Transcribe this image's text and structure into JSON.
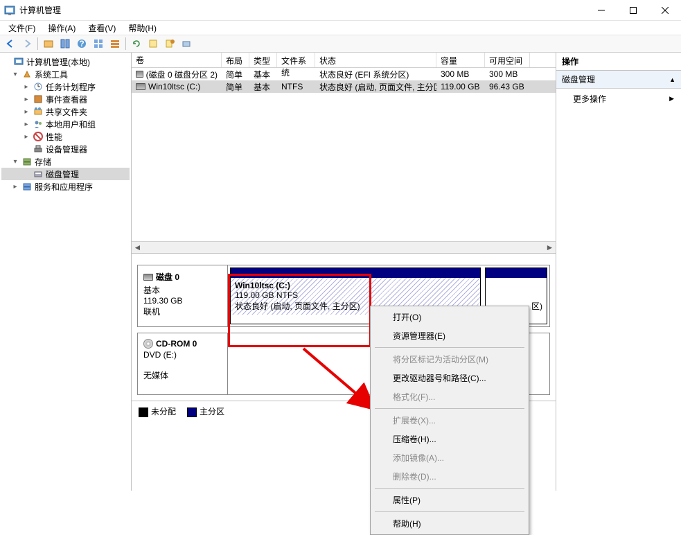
{
  "window": {
    "title": "计算机管理"
  },
  "menus": {
    "file": "文件(F)",
    "action": "操作(A)",
    "view": "查看(V)",
    "help": "帮助(H)"
  },
  "tree": {
    "root": "计算机管理(本地)",
    "system_tools": "系统工具",
    "task_scheduler": "任务计划程序",
    "event_viewer": "事件查看器",
    "shared_folders": "共享文件夹",
    "local_users": "本地用户和组",
    "performance": "性能",
    "device_manager": "设备管理器",
    "storage": "存储",
    "disk_management": "磁盘管理",
    "services_apps": "服务和应用程序"
  },
  "volcols": {
    "volume": "卷",
    "layout": "布局",
    "type": "类型",
    "fs": "文件系统",
    "status": "状态",
    "capacity": "容量",
    "free": "可用空间"
  },
  "volumes": [
    {
      "name": "(磁盘 0 磁盘分区 2)",
      "layout": "简单",
      "type": "基本",
      "fs": "",
      "status": "状态良好 (EFI 系统分区)",
      "capacity": "300 MB",
      "free": "300 MB"
    },
    {
      "name": "Win10ltsc (C:)",
      "layout": "简单",
      "type": "基本",
      "fs": "NTFS",
      "status": "状态良好 (启动, 页面文件, 主分区)",
      "capacity": "119.00 GB",
      "free": "96.43 GB"
    }
  ],
  "disks": {
    "disk0": {
      "label": "磁盘 0",
      "type": "基本",
      "size": "119.30 GB",
      "status": "联机"
    },
    "cdrom0": {
      "label": "CD-ROM 0",
      "type": "DVD (E:)",
      "status": "无媒体"
    }
  },
  "parts": {
    "c": {
      "name": "Win10ltsc  (C:)",
      "size": "119.00 GB NTFS",
      "status": "状态良好 (启动, 页面文件, 主分区)"
    },
    "efi_tail": "区)"
  },
  "legend": {
    "unallocated": "未分配",
    "primary": "主分区"
  },
  "actions": {
    "header": "操作",
    "group": "磁盘管理",
    "more": "更多操作"
  },
  "ctx": {
    "open": "打开(O)",
    "explorer": "资源管理器(E)",
    "mark_active": "将分区标记为活动分区(M)",
    "change_letter": "更改驱动器号和路径(C)...",
    "format": "格式化(F)...",
    "extend": "扩展卷(X)...",
    "shrink": "压缩卷(H)...",
    "add_mirror": "添加镜像(A)...",
    "delete": "删除卷(D)...",
    "properties": "属性(P)",
    "help": "帮助(H)"
  }
}
